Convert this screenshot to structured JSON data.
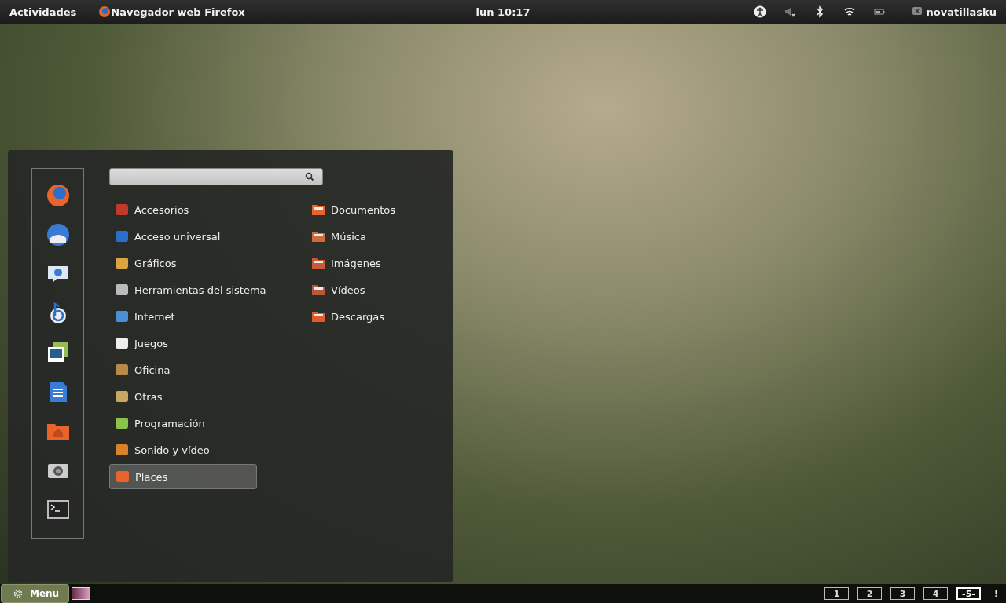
{
  "top_bar": {
    "activities": "Actividades",
    "app_name": "Navegador web Firefox",
    "clock": "lun 10:17",
    "user": "novatillasku"
  },
  "menu": {
    "categories": [
      {
        "label": "Accesorios",
        "selected": false
      },
      {
        "label": "Acceso universal",
        "selected": false
      },
      {
        "label": "Gráficos",
        "selected": false
      },
      {
        "label": "Herramientas del sistema",
        "selected": false
      },
      {
        "label": "Internet",
        "selected": false
      },
      {
        "label": "Juegos",
        "selected": false
      },
      {
        "label": "Oficina",
        "selected": false
      },
      {
        "label": "Otras",
        "selected": false
      },
      {
        "label": "Programación",
        "selected": false
      },
      {
        "label": "Sonido y vídeo",
        "selected": false
      },
      {
        "label": "Places",
        "selected": true
      }
    ],
    "places": [
      {
        "label": "Documentos"
      },
      {
        "label": "Música"
      },
      {
        "label": "Imágenes"
      },
      {
        "label": "Vídeos"
      },
      {
        "label": "Descargas"
      }
    ]
  },
  "bottom_bar": {
    "menu_button": "Menu",
    "workspaces": [
      {
        "label": "1",
        "selected": false
      },
      {
        "label": "2",
        "selected": false
      },
      {
        "label": "3",
        "selected": false
      },
      {
        "label": "4",
        "selected": false
      },
      {
        "label": "-5-",
        "selected": true
      }
    ],
    "notice": "!"
  }
}
